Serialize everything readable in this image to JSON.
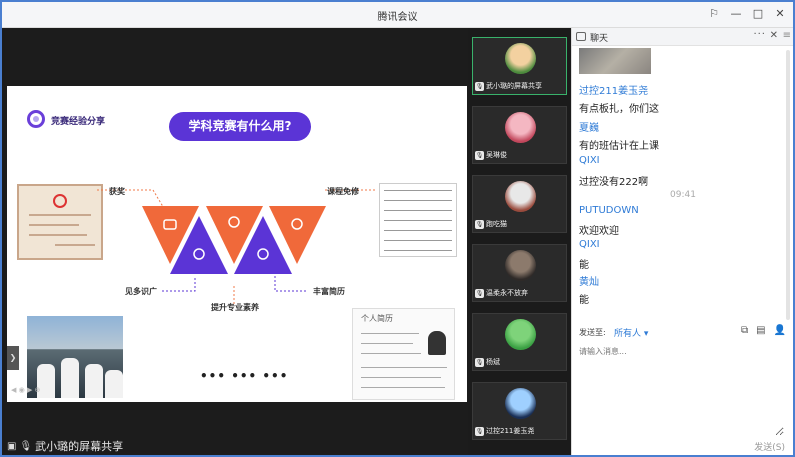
{
  "window": {
    "title": "腾讯会议",
    "controls": [
      "⚐",
      "—",
      "□",
      "✕"
    ]
  },
  "stage": {
    "share_label": "武小璐的屏幕共享",
    "slide": {
      "brand": "竞赛经验分享",
      "headline": "学科竞赛有什么用?",
      "labels": {
        "award": "获奖",
        "exempt": "课程免修",
        "insight": "见多识广",
        "resume": "丰富简历",
        "quality": "提升专业素养"
      },
      "resume_heading": "个人简历",
      "dots": "••• ••• •••"
    }
  },
  "participants": [
    {
      "name": "武小璐的屏幕共享",
      "avatar_colors": [
        "#f3d1a0",
        "#4c8b3d"
      ],
      "active": true
    },
    {
      "name": "吴琳俊",
      "avatar_colors": [
        "#f4b7c2",
        "#c2475c"
      ],
      "active": false
    },
    {
      "name": "跑吃猫",
      "avatar_colors": [
        "#e8e8e8",
        "#9a4b3d"
      ],
      "active": false
    },
    {
      "name": "温柔永不放弃",
      "avatar_colors": [
        "#8c7a6c",
        "#2f2a28"
      ],
      "active": false
    },
    {
      "name": "杨斌",
      "avatar_colors": [
        "#7ed37a",
        "#3aa043"
      ],
      "active": false
    },
    {
      "name": "过控211姜玉尧",
      "avatar_colors": [
        "#9fd0ff",
        "#1a2f55"
      ],
      "active": false
    }
  ],
  "chat": {
    "title": "聊天",
    "more": "···",
    "close": "✕",
    "menu": "≡",
    "messages": [
      {
        "name": "过控211姜玉尧",
        "text": "有点板扎，你们这"
      },
      {
        "name": "夏巍",
        "text": "有的班估计在上课"
      },
      {
        "name": "QIXI",
        "text": "过控没有222啊"
      },
      {
        "time": "09:41"
      },
      {
        "name": "PUTUDOWN",
        "text": "欢迎欢迎"
      },
      {
        "name": "QIXI",
        "text": "能"
      },
      {
        "name": "黄灿",
        "text": "能"
      }
    ],
    "send_to_label": "发送至:",
    "send_to_value": "所有人 ▾",
    "input_placeholder": "请输入消息...",
    "send_button": "发送(S)",
    "tool_icons": [
      "⧉",
      "▤",
      "👤"
    ]
  }
}
